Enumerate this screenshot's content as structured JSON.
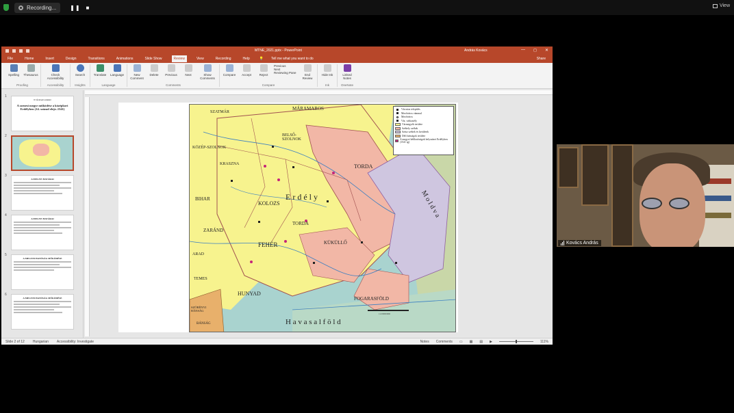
{
  "recorder": {
    "status": "Recording...",
    "pause_icon": "pause-icon",
    "stop_icon": "stop-icon",
    "view_label": "View"
  },
  "ppt": {
    "doc_title": "MTNE_2021.pptx  -  PowerPoint",
    "user_name": "András Kovács",
    "tabs": [
      "File",
      "Home",
      "Insert",
      "Design",
      "Transitions",
      "Animations",
      "Slide Show",
      "Review",
      "View",
      "Recording",
      "Help"
    ],
    "active_tab": "Review",
    "tell_me": "Tell me what you want to do",
    "share": "Share",
    "ribbon_groups": [
      {
        "name": "Proofing",
        "buttons": [
          "Spelling",
          "Thesaurus"
        ]
      },
      {
        "name": "Accessibility",
        "buttons": [
          "Check Accessibility"
        ]
      },
      {
        "name": "Insights",
        "buttons": [
          "Search"
        ]
      },
      {
        "name": "Language",
        "buttons": [
          "Translate",
          "Language"
        ]
      },
      {
        "name": "Comments",
        "buttons": [
          "New Comment",
          "Delete",
          "Previous",
          "Next",
          "Show Comments"
        ]
      },
      {
        "name": "Compare",
        "buttons": [
          "Compare",
          "Accept",
          "Reject",
          "Previous",
          "Next",
          "Reviewing Pane",
          "End Review"
        ]
      },
      {
        "name": "Ink",
        "buttons": [
          "Hide Ink"
        ]
      },
      {
        "name": "OneNote",
        "buttons": [
          "Linked Notes"
        ]
      }
    ],
    "thumbnails": [
      {
        "num": "1",
        "title": "A szenesi megye működése a középkori Erdélyben (14. század eleje–1541)",
        "subtitle": "IV. Évtizedi szakkör"
      },
      {
        "num": "2",
        "title": ""
      },
      {
        "num": "3",
        "title": "A MEGYE HATÁRAI"
      },
      {
        "num": "4",
        "title": "A MEGYE HATÁRAI"
      },
      {
        "num": "5",
        "title": "A MEGYEI HATÓSÁG MŰKÖDÉSE"
      },
      {
        "num": "6",
        "title": "A MEGYEI HATÓSÁG MŰKÖDÉSE"
      }
    ],
    "status": {
      "slide": "Slide 2 of 12",
      "language": "Hungarian",
      "accessibility": "Accessibility: Investigate",
      "notes": "Notes",
      "comments": "Comments",
      "zoom": "111%"
    }
  },
  "map": {
    "legend": [
      {
        "label": "Városias település",
        "kind": "symbol"
      },
      {
        "label": "Mezőváros vámmal",
        "kind": "symbol"
      },
      {
        "label": "Mezőváros",
        "kind": "symbol"
      },
      {
        "label": "Vár, várkastély",
        "kind": "symbol"
      },
      {
        "label": "Vármegyék területe",
        "kind": "swatch",
        "color": "#f7f38e"
      },
      {
        "label": "Székely székek",
        "kind": "swatch",
        "color": "#f2b7a6"
      },
      {
        "label": "Szász székek és kerületek",
        "kind": "swatch",
        "color": "#cfc6e0"
      },
      {
        "label": "Déli bánságok területe",
        "kind": "swatch",
        "color": "#e8b06b"
      },
      {
        "label": "A megyei hélíhatóságok helyszínei Erdélyben (1541 ig)",
        "kind": "swatch",
        "color": "#c4247a"
      }
    ],
    "labels": {
      "maramaros": "MÁRAMAROS",
      "szatmar": "SZATMÁR",
      "kozep_szolnok": "KÖZÉP-SZOLNOK",
      "belso_szolnok": "BELSŐ-SZOLNOK",
      "kraszna": "KRASZNA",
      "bihar": "BIHAR",
      "torda_n": "TORDA",
      "torda_s": "TORDA",
      "kolozs": "KOLOZS",
      "erdely": "E r d é l y",
      "zarand": "ZARÁND",
      "feher": "FEHÉR",
      "kukullo": "KÜKÜLLŐ",
      "arad": "ARAD",
      "temes": "TEMES",
      "hunyad": "HUNYAD",
      "fogaras": "FOGARASFÖLD",
      "havasalfold": "H a v a s a l f ö l d",
      "moldva": "M o l d v a",
      "szoreny": "SZÖRÉNYI BÁNSÁG",
      "banksag": "BÁNSÁG",
      "scale": "1:2 000 000"
    }
  },
  "speaker": {
    "name": "Kovács András"
  }
}
